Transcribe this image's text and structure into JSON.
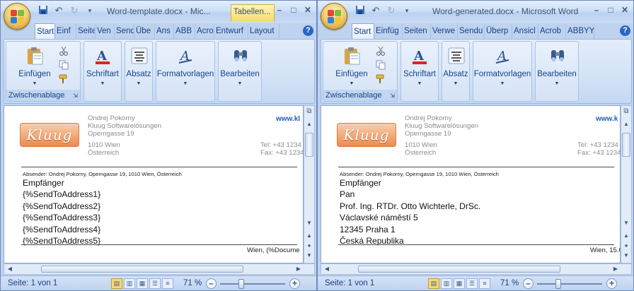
{
  "windows": [
    {
      "title": "Word-template.docx - Mic...",
      "contextual_tab": "Tabellen...",
      "tabs": [
        "Start",
        "Einf",
        "Seite",
        "Ven",
        "Send",
        "Übe",
        "Ans",
        "ABB",
        "Acro",
        "Entwurf",
        "Layout"
      ],
      "ribbon": {
        "paste": "Einfügen",
        "clipboard_group": "Zwischenablage",
        "font": "Schriftart",
        "paragraph": "Absatz",
        "styles": "Formatvorlagen",
        "edit": "Bearbeiten"
      },
      "doc": {
        "logo_text": "Kluug",
        "sender_lines": [
          "Ondrej Pokorny",
          "Kluug Softwarelösungen",
          "Operngasse 19",
          "1010 Wien",
          "Österreich"
        ],
        "www": "www.kl",
        "tel": "Tel: +43 1234",
        "fax": "Fax: +43 1234",
        "absender": "Absender: Ondrej Pokorny, Operngasse 19, 1010 Wien, Österreich",
        "address_lines": [
          "Empfänger",
          "{%SendToAddress1}",
          "{%SendToAddress2}",
          "{%SendToAddress3}",
          "{%SendToAddress4}",
          "{%SendToAddress5}"
        ],
        "city_date": "Wien, {%Docume"
      },
      "status": {
        "pages": "Seite: 1 von 1",
        "zoom": "71 %"
      }
    },
    {
      "title": "Word-generated.docx - Microsoft Word",
      "contextual_tab": "",
      "tabs": [
        "Start",
        "Einfüg",
        "Seiten",
        "Verwe",
        "Sendu",
        "Überp",
        "Ansicl",
        "Acrob",
        "ABBYY"
      ],
      "ribbon": {
        "paste": "Einfügen",
        "clipboard_group": "Zwischenablage",
        "font": "Schriftart",
        "paragraph": "Absatz",
        "styles": "Formatvorlagen",
        "edit": "Bearbeiten"
      },
      "doc": {
        "logo_text": "Kluug",
        "sender_lines": [
          "Ondrej Pokorny",
          "Kluug Softwarelösungen",
          "Operngasse 19",
          "1010 Wien",
          "Österreich"
        ],
        "www": "www.k",
        "tel": "Tel: +43 1234",
        "fax": "Fax: +43 1234",
        "absender": "Absender: Ondrej Pokorny, Operngasse 19, 1010 Wien, Österreich",
        "address_lines": [
          "Empfänger",
          "Pan",
          "Prof. Ing. RTDr. Otto Wichterle, DrSc.",
          "Václavské náměstí 5",
          "12345 Praha 1",
          "Česká Republika"
        ],
        "city_date": "Wien, 15.0"
      },
      "status": {
        "pages": "Seite: 1 von 1",
        "zoom": "71 %"
      }
    }
  ]
}
